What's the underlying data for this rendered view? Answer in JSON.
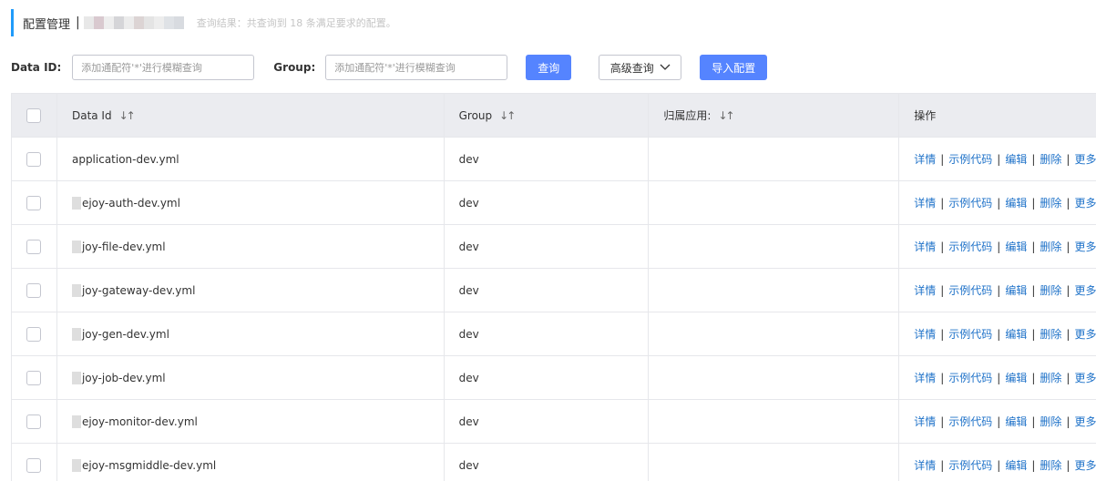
{
  "header": {
    "title": "配置管理",
    "separator": "|",
    "result_text": "查询结果：共查询到 18 条满足要求的配置。"
  },
  "filters": {
    "data_id_label": "Data ID:",
    "data_id_placeholder": "添加通配符'*'进行模糊查询",
    "group_label": "Group:",
    "group_placeholder": "添加通配符'*'进行模糊查询",
    "search_button": "查询",
    "advanced_button": "高级查询",
    "import_button": "导入配置"
  },
  "table": {
    "columns": [
      "Data Id",
      "Group",
      "归属应用:",
      "操作"
    ],
    "sort_icon": "↓↑",
    "rows": [
      {
        "data_id": "application-dev.yml",
        "group": "dev",
        "app": ""
      },
      {
        "data_id": "ejoy-auth-dev.yml",
        "group": "dev",
        "app": ""
      },
      {
        "data_id": "joy-file-dev.yml",
        "group": "dev",
        "app": ""
      },
      {
        "data_id": "joy-gateway-dev.yml",
        "group": "dev",
        "app": ""
      },
      {
        "data_id": "joy-gen-dev.yml",
        "group": "dev",
        "app": ""
      },
      {
        "data_id": "joy-job-dev.yml",
        "group": "dev",
        "app": ""
      },
      {
        "data_id": "ejoy-monitor-dev.yml",
        "group": "dev",
        "app": ""
      },
      {
        "data_id": "ejoy-msgmiddle-dev.yml",
        "group": "dev",
        "app": ""
      }
    ],
    "actions": [
      "详情",
      "示例代码",
      "编辑",
      "删除",
      "更多"
    ],
    "action_sep": "|"
  },
  "colors": {
    "accent": "#209bfa",
    "primary_button": "#5584ff",
    "link": "#2073c9",
    "header_bg": "#ebecf0"
  }
}
